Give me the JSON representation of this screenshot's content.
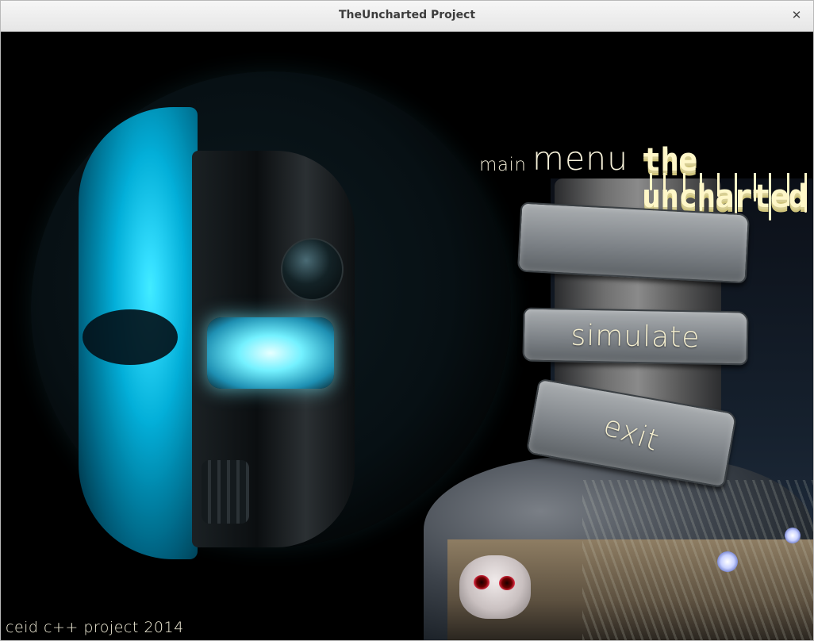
{
  "window": {
    "title": "TheUncharted Project",
    "close_glyph": "✕"
  },
  "menu": {
    "heading_main": "main",
    "heading_menu": "menu",
    "game_title": "the uncharted",
    "buttons": [
      {
        "id": "blank",
        "label": ""
      },
      {
        "id": "simulate",
        "label": "simulate"
      },
      {
        "id": "exit",
        "label": "exit"
      }
    ]
  },
  "footer": {
    "credit": "ceid c++ project 2014"
  },
  "icons": {
    "close": "close-icon",
    "skull_art": "skull-robot-art",
    "tree_art": "tree-scene-art"
  },
  "colors": {
    "text": "#f5efcf",
    "title_text": "#fff7c8",
    "cyan_glow": "#59e6ff",
    "background": "#000000"
  }
}
